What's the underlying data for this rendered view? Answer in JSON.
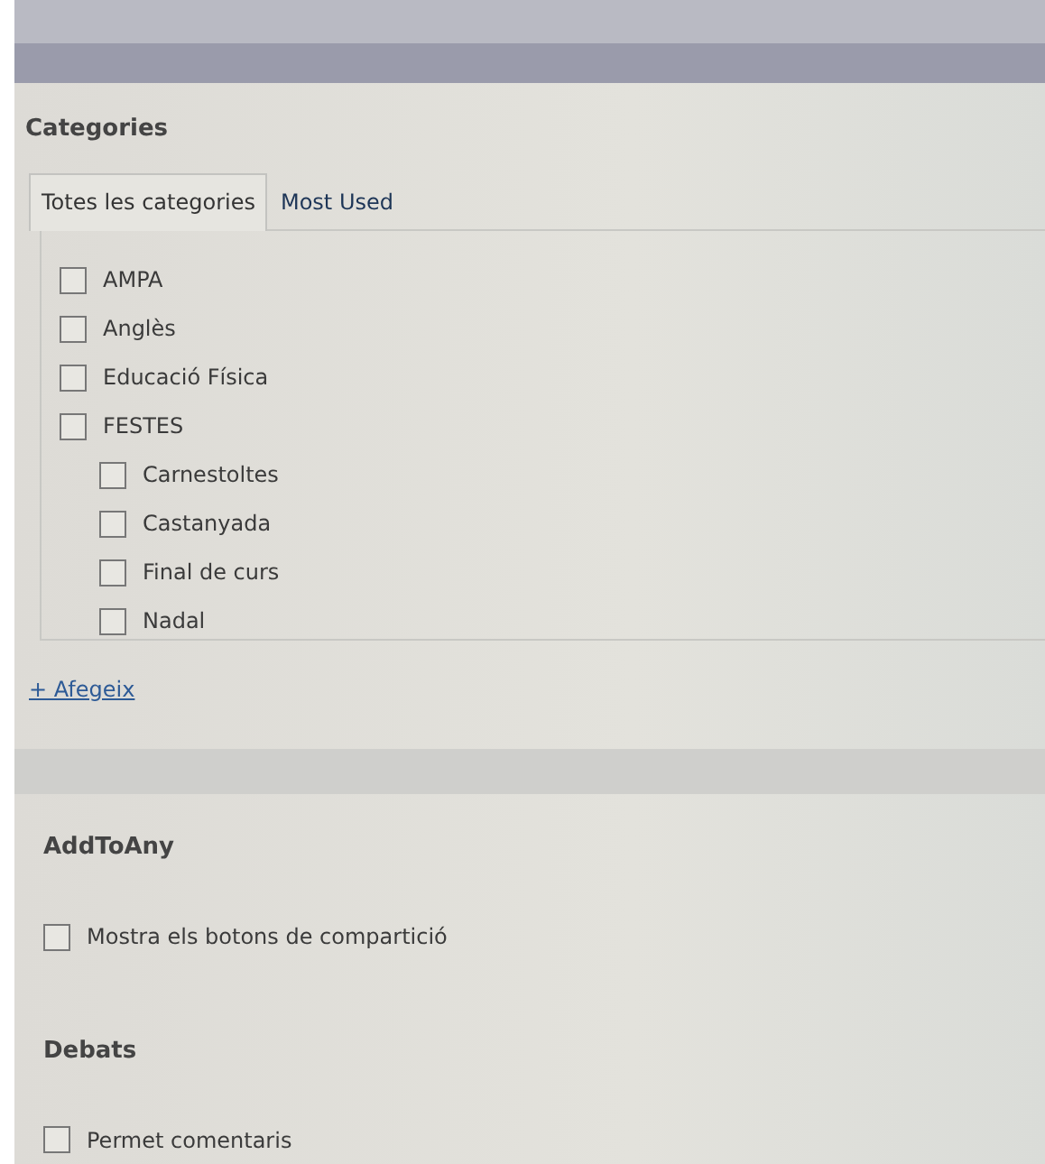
{
  "categories_box": {
    "title": "Categories",
    "tabs": [
      {
        "label": "Totes les categories",
        "selected": true
      },
      {
        "label": "Most Used",
        "selected": false
      }
    ],
    "items": [
      {
        "label": "AMPA",
        "checked": false
      },
      {
        "label": "Anglès",
        "checked": false
      },
      {
        "label": "Educació Física",
        "checked": false
      },
      {
        "label": "FESTES",
        "checked": false,
        "children": [
          {
            "label": "Carnestoltes",
            "checked": false
          },
          {
            "label": "Castanyada",
            "checked": false
          },
          {
            "label": "Final de curs",
            "checked": false
          },
          {
            "label": "Nadal",
            "checked": false
          }
        ]
      }
    ],
    "add_link": "+ Afegeix"
  },
  "sections": [
    {
      "title": "AddToAny",
      "options": [
        {
          "label": "Mostra els botons de compartició",
          "checked": false
        }
      ]
    },
    {
      "title": "Debats",
      "options": [
        {
          "label": "Permet comentaris",
          "checked": false
        }
      ]
    }
  ]
}
